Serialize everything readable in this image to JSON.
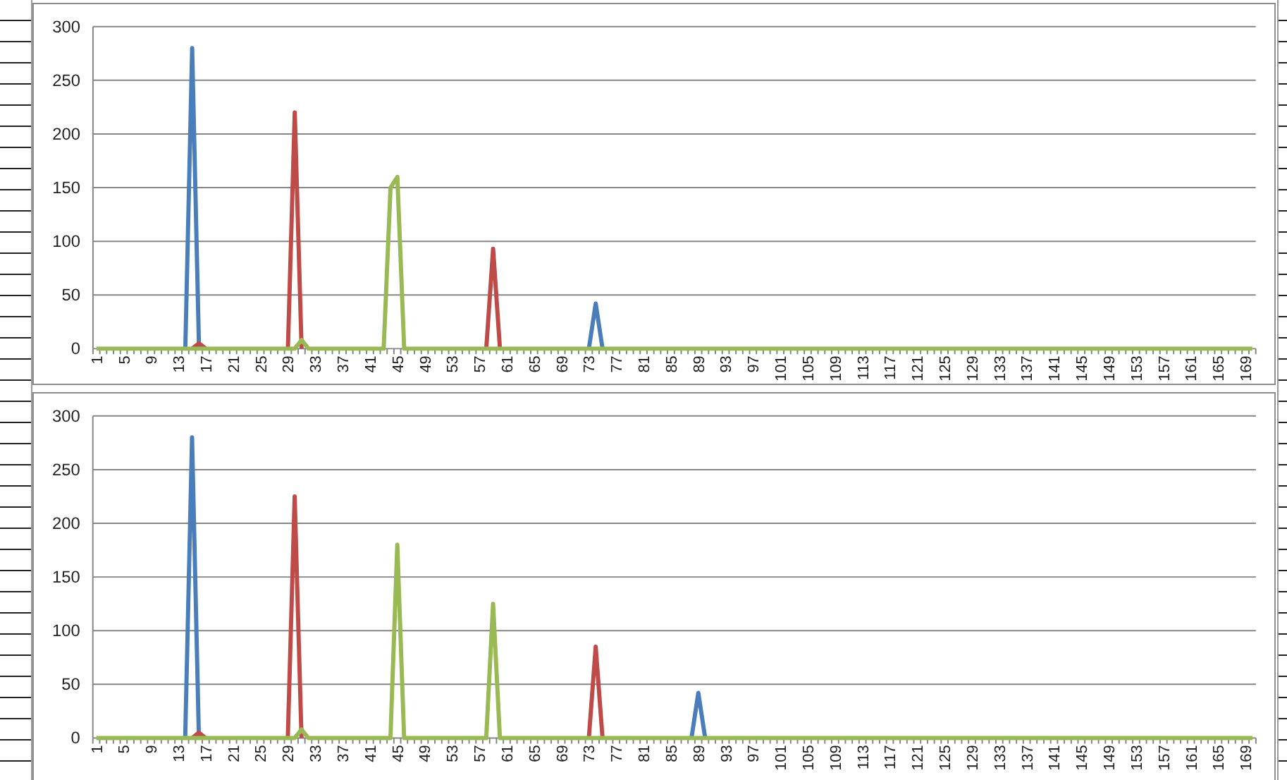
{
  "charts": [
    {
      "chart_data": {
        "type": "line",
        "grid": true,
        "ylim": [
          0,
          300
        ],
        "yticks": [
          0,
          50,
          100,
          150,
          200,
          250,
          300
        ],
        "xlim": [
          0.5,
          170.5
        ],
        "xticks": [
          1,
          5,
          9,
          13,
          17,
          21,
          25,
          29,
          33,
          37,
          41,
          45,
          49,
          53,
          57,
          61,
          65,
          69,
          73,
          77,
          81,
          85,
          89,
          93,
          97,
          101,
          105,
          109,
          113,
          117,
          121,
          125,
          129,
          133,
          137,
          141,
          145,
          149,
          153,
          157,
          161,
          165,
          169
        ],
        "x": [
          1,
          2,
          3,
          4,
          5,
          6,
          7,
          8,
          9,
          10,
          11,
          12,
          13,
          14,
          15,
          16,
          17,
          18,
          19,
          20,
          21,
          22,
          23,
          24,
          25,
          26,
          27,
          28,
          29,
          30,
          31,
          32,
          33,
          34,
          35,
          36,
          37,
          38,
          39,
          40,
          41,
          42,
          43,
          44,
          45,
          46,
          47,
          48,
          49,
          50,
          51,
          52,
          53,
          54,
          55,
          56,
          57,
          58,
          59,
          60,
          61,
          62,
          63,
          64,
          65,
          66,
          67,
          68,
          69,
          70,
          71,
          72,
          73,
          74,
          75,
          76,
          77,
          78,
          79,
          80,
          81,
          82,
          83,
          84,
          85,
          86,
          87,
          88,
          89,
          90,
          91,
          92,
          93,
          94,
          95,
          96,
          97,
          98,
          99,
          100,
          101,
          102,
          103,
          104,
          105,
          106,
          107,
          108,
          109,
          110,
          111,
          112,
          113,
          114,
          115,
          116,
          117,
          118,
          119,
          120,
          121,
          122,
          123,
          124,
          125,
          126,
          127,
          128,
          129,
          130,
          131,
          132,
          133,
          134,
          135,
          136,
          137,
          138,
          139,
          140,
          141,
          142,
          143,
          144,
          145,
          146,
          147,
          148,
          149,
          150,
          151,
          152,
          153,
          154,
          155,
          156,
          157,
          158,
          159,
          160,
          161,
          162,
          163,
          164,
          165,
          166,
          167,
          168,
          169,
          170
        ],
        "series": [
          {
            "color": "#4a7ebb",
            "values": [
              null,
              null,
              null,
              null,
              null,
              null,
              null,
              null,
              null,
              null,
              null,
              null,
              null,
              0,
              280,
              0,
              null,
              null,
              null,
              null,
              null,
              null,
              null,
              null,
              null,
              null,
              null,
              null,
              null,
              null,
              null,
              null,
              null,
              null,
              null,
              null,
              null,
              null,
              null,
              null,
              null,
              null,
              null,
              null,
              null,
              null,
              null,
              null,
              null,
              null,
              null,
              null,
              null,
              null,
              null,
              null,
              null,
              null,
              null,
              null,
              null,
              null,
              null,
              null,
              null,
              null,
              null,
              null,
              null,
              null,
              null,
              null,
              0,
              42,
              0,
              null,
              null,
              null,
              null,
              null,
              null,
              null,
              null,
              null,
              null,
              null,
              null,
              null,
              null,
              null,
              null,
              null,
              null,
              null,
              null,
              null,
              null,
              null,
              null,
              null,
              null,
              null,
              null,
              null,
              null,
              null,
              null,
              null,
              null,
              null,
              null,
              null,
              null,
              null,
              null,
              null,
              null,
              null,
              null,
              null,
              null,
              null,
              null,
              null,
              null,
              null,
              null,
              null,
              null,
              null,
              null,
              null,
              null,
              null,
              null,
              null,
              null,
              null,
              null,
              null,
              null,
              null,
              null,
              null,
              null,
              null,
              null,
              null,
              null,
              null,
              null,
              null,
              null,
              null,
              null,
              null,
              null,
              null,
              null,
              null,
              null,
              null,
              null,
              null,
              null,
              null,
              null,
              null,
              null,
              null
            ]
          },
          {
            "color": "#be4b48",
            "values": [
              null,
              null,
              null,
              null,
              null,
              null,
              null,
              null,
              null,
              null,
              null,
              null,
              null,
              null,
              0,
              5,
              0,
              null,
              null,
              null,
              null,
              null,
              null,
              null,
              null,
              null,
              null,
              null,
              0,
              220,
              0,
              null,
              null,
              null,
              null,
              null,
              null,
              null,
              null,
              null,
              null,
              null,
              null,
              null,
              null,
              null,
              null,
              null,
              null,
              null,
              null,
              null,
              null,
              null,
              null,
              null,
              null,
              0,
              93,
              0,
              null,
              null,
              null,
              null,
              null,
              null,
              null,
              null,
              null,
              null,
              null,
              null,
              null,
              null,
              null,
              null,
              null,
              null,
              null,
              null,
              null,
              null,
              null,
              null,
              null,
              null,
              null,
              null,
              null,
              null,
              null,
              null,
              null,
              null,
              null,
              null,
              null,
              null,
              null,
              null,
              null,
              null,
              null,
              null,
              null,
              null,
              null,
              null,
              null,
              null,
              null,
              null,
              null,
              null,
              null,
              null,
              null,
              null,
              null,
              null,
              null,
              null,
              null,
              null,
              null,
              null,
              null,
              null,
              null,
              null,
              null,
              null,
              null,
              null,
              null,
              null,
              null,
              null,
              null,
              null,
              null,
              null,
              null,
              null,
              null,
              null,
              null,
              null,
              null,
              null,
              null,
              null,
              null,
              null,
              null,
              null,
              null,
              null,
              null,
              null,
              null,
              null,
              null,
              null,
              null,
              null,
              null,
              null,
              null,
              null
            ]
          },
          {
            "color": "#98b954",
            "values": [
              0,
              0,
              0,
              0,
              0,
              0,
              0,
              0,
              0,
              0,
              0,
              0,
              0,
              0,
              0,
              0,
              0,
              0,
              0,
              0,
              0,
              0,
              0,
              0,
              0,
              0,
              0,
              0,
              0,
              0,
              8,
              0,
              0,
              0,
              0,
              0,
              0,
              0,
              0,
              0,
              0,
              0,
              0,
              150,
              160,
              0,
              0,
              0,
              0,
              0,
              0,
              0,
              0,
              0,
              0,
              0,
              0,
              0,
              0,
              0,
              0,
              0,
              0,
              0,
              0,
              0,
              0,
              0,
              0,
              0,
              0,
              0,
              0,
              0,
              0,
              0,
              0,
              0,
              0,
              0,
              0,
              0,
              0,
              0,
              0,
              0,
              0,
              0,
              0,
              0,
              0,
              0,
              0,
              0,
              0,
              0,
              0,
              0,
              0,
              0,
              0,
              0,
              0,
              0,
              0,
              0,
              0,
              0,
              0,
              0,
              0,
              0,
              0,
              0,
              0,
              0,
              0,
              0,
              0,
              0,
              0,
              0,
              0,
              0,
              0,
              0,
              0,
              0,
              0,
              0,
              0,
              0,
              0,
              0,
              0,
              0,
              0,
              0,
              0,
              0,
              0,
              0,
              0,
              0,
              0,
              0,
              0,
              0,
              0,
              0,
              0,
              0,
              0,
              0,
              0,
              0,
              0,
              0,
              0,
              0,
              0,
              0,
              0,
              0,
              0,
              0,
              0,
              0,
              0,
              0
            ]
          }
        ]
      }
    },
    {
      "chart_data": {
        "type": "line",
        "grid": true,
        "ylim": [
          0,
          300
        ],
        "yticks": [
          0,
          50,
          100,
          150,
          200,
          250,
          300
        ],
        "xlim": [
          0.5,
          170.5
        ],
        "xticks": [
          1,
          5,
          9,
          13,
          17,
          21,
          25,
          29,
          33,
          37,
          41,
          45,
          49,
          53,
          57,
          61,
          65,
          69,
          73,
          77,
          81,
          85,
          89,
          93,
          97,
          101,
          105,
          109,
          113,
          117,
          121,
          125,
          129,
          133,
          137,
          141,
          145,
          149,
          153,
          157,
          161,
          165,
          169
        ],
        "x": [
          1,
          2,
          3,
          4,
          5,
          6,
          7,
          8,
          9,
          10,
          11,
          12,
          13,
          14,
          15,
          16,
          17,
          18,
          19,
          20,
          21,
          22,
          23,
          24,
          25,
          26,
          27,
          28,
          29,
          30,
          31,
          32,
          33,
          34,
          35,
          36,
          37,
          38,
          39,
          40,
          41,
          42,
          43,
          44,
          45,
          46,
          47,
          48,
          49,
          50,
          51,
          52,
          53,
          54,
          55,
          56,
          57,
          58,
          59,
          60,
          61,
          62,
          63,
          64,
          65,
          66,
          67,
          68,
          69,
          70,
          71,
          72,
          73,
          74,
          75,
          76,
          77,
          78,
          79,
          80,
          81,
          82,
          83,
          84,
          85,
          86,
          87,
          88,
          89,
          90,
          91,
          92,
          93,
          94,
          95,
          96,
          97,
          98,
          99,
          100,
          101,
          102,
          103,
          104,
          105,
          106,
          107,
          108,
          109,
          110,
          111,
          112,
          113,
          114,
          115,
          116,
          117,
          118,
          119,
          120,
          121,
          122,
          123,
          124,
          125,
          126,
          127,
          128,
          129,
          130,
          131,
          132,
          133,
          134,
          135,
          136,
          137,
          138,
          139,
          140,
          141,
          142,
          143,
          144,
          145,
          146,
          147,
          148,
          149,
          150,
          151,
          152,
          153,
          154,
          155,
          156,
          157,
          158,
          159,
          160,
          161,
          162,
          163,
          164,
          165,
          166,
          167,
          168,
          169,
          170
        ],
        "series": [
          {
            "color": "#4a7ebb",
            "values": [
              null,
              null,
              null,
              null,
              null,
              null,
              null,
              null,
              null,
              null,
              null,
              null,
              null,
              0,
              280,
              0,
              null,
              null,
              null,
              null,
              null,
              null,
              null,
              null,
              null,
              null,
              null,
              null,
              null,
              null,
              null,
              null,
              null,
              null,
              null,
              null,
              null,
              null,
              null,
              null,
              null,
              null,
              null,
              null,
              null,
              null,
              null,
              null,
              null,
              null,
              null,
              null,
              null,
              null,
              null,
              null,
              null,
              null,
              null,
              null,
              null,
              null,
              null,
              null,
              null,
              null,
              null,
              null,
              null,
              null,
              null,
              null,
              null,
              null,
              null,
              null,
              null,
              null,
              null,
              null,
              null,
              null,
              null,
              null,
              null,
              null,
              null,
              0,
              42,
              0,
              null,
              null,
              null,
              null,
              null,
              null,
              null,
              null,
              null,
              null,
              null,
              null,
              null,
              null,
              null,
              null,
              null,
              null,
              null,
              null,
              null,
              null,
              null,
              null,
              null,
              null,
              null,
              null,
              null,
              null,
              null,
              null,
              null,
              null,
              null,
              null,
              null,
              null,
              null,
              null,
              null,
              null,
              null,
              null,
              null,
              null,
              null,
              null,
              null,
              null,
              null,
              null,
              null,
              null,
              null,
              null,
              null,
              null,
              null,
              null,
              null,
              null,
              null,
              null,
              null,
              null,
              null,
              null,
              null,
              null,
              null,
              null,
              null,
              null,
              null,
              null,
              null,
              null,
              null,
              null
            ]
          },
          {
            "color": "#be4b48",
            "values": [
              null,
              null,
              null,
              null,
              null,
              null,
              null,
              null,
              null,
              null,
              null,
              null,
              null,
              null,
              0,
              5,
              0,
              null,
              null,
              null,
              null,
              null,
              null,
              null,
              null,
              null,
              null,
              null,
              0,
              225,
              0,
              null,
              null,
              null,
              null,
              null,
              null,
              null,
              null,
              null,
              null,
              null,
              null,
              null,
              null,
              null,
              null,
              null,
              null,
              null,
              null,
              null,
              null,
              null,
              null,
              null,
              null,
              null,
              null,
              null,
              null,
              null,
              null,
              null,
              null,
              null,
              null,
              null,
              null,
              null,
              null,
              null,
              0,
              85,
              0,
              null,
              null,
              null,
              null,
              null,
              null,
              null,
              null,
              null,
              null,
              null,
              null,
              null,
              null,
              null,
              null,
              null,
              null,
              null,
              null,
              null,
              null,
              null,
              null,
              null,
              null,
              null,
              null,
              null,
              null,
              null,
              null,
              null,
              null,
              null,
              null,
              null,
              null,
              null,
              null,
              null,
              null,
              null,
              null,
              null,
              null,
              null,
              null,
              null,
              null,
              null,
              null,
              null,
              null,
              null,
              null,
              null,
              null,
              null,
              null,
              null,
              null,
              null,
              null,
              null,
              null,
              null,
              null,
              null,
              null,
              null,
              null,
              null,
              null,
              null,
              null,
              null,
              null,
              null,
              null,
              null,
              null,
              null,
              null,
              null,
              null,
              null,
              null,
              null,
              null,
              null,
              null,
              null,
              null,
              null
            ]
          },
          {
            "color": "#98b954",
            "values": [
              0,
              0,
              0,
              0,
              0,
              0,
              0,
              0,
              0,
              0,
              0,
              0,
              0,
              0,
              0,
              0,
              0,
              0,
              0,
              0,
              0,
              0,
              0,
              0,
              0,
              0,
              0,
              0,
              0,
              0,
              8,
              0,
              0,
              0,
              0,
              0,
              0,
              0,
              0,
              0,
              0,
              0,
              0,
              0,
              180,
              0,
              0,
              0,
              0,
              0,
              0,
              0,
              0,
              0,
              0,
              0,
              0,
              0,
              125,
              0,
              0,
              0,
              0,
              0,
              0,
              0,
              0,
              0,
              0,
              0,
              0,
              0,
              0,
              0,
              0,
              0,
              0,
              0,
              0,
              0,
              0,
              0,
              0,
              0,
              0,
              0,
              0,
              0,
              0,
              0,
              0,
              0,
              0,
              0,
              0,
              0,
              0,
              0,
              0,
              0,
              0,
              0,
              0,
              0,
              0,
              0,
              0,
              0,
              0,
              0,
              0,
              0,
              0,
              0,
              0,
              0,
              0,
              0,
              0,
              0,
              0,
              0,
              0,
              0,
              0,
              0,
              0,
              0,
              0,
              0,
              0,
              0,
              0,
              0,
              0,
              0,
              0,
              0,
              0,
              0,
              0,
              0,
              0,
              0,
              0,
              0,
              0,
              0,
              0,
              0,
              0,
              0,
              0,
              0,
              0,
              0,
              0,
              0,
              0,
              0,
              0,
              0,
              0,
              0,
              0,
              0,
              0,
              0,
              0,
              0
            ]
          }
        ]
      }
    }
  ]
}
